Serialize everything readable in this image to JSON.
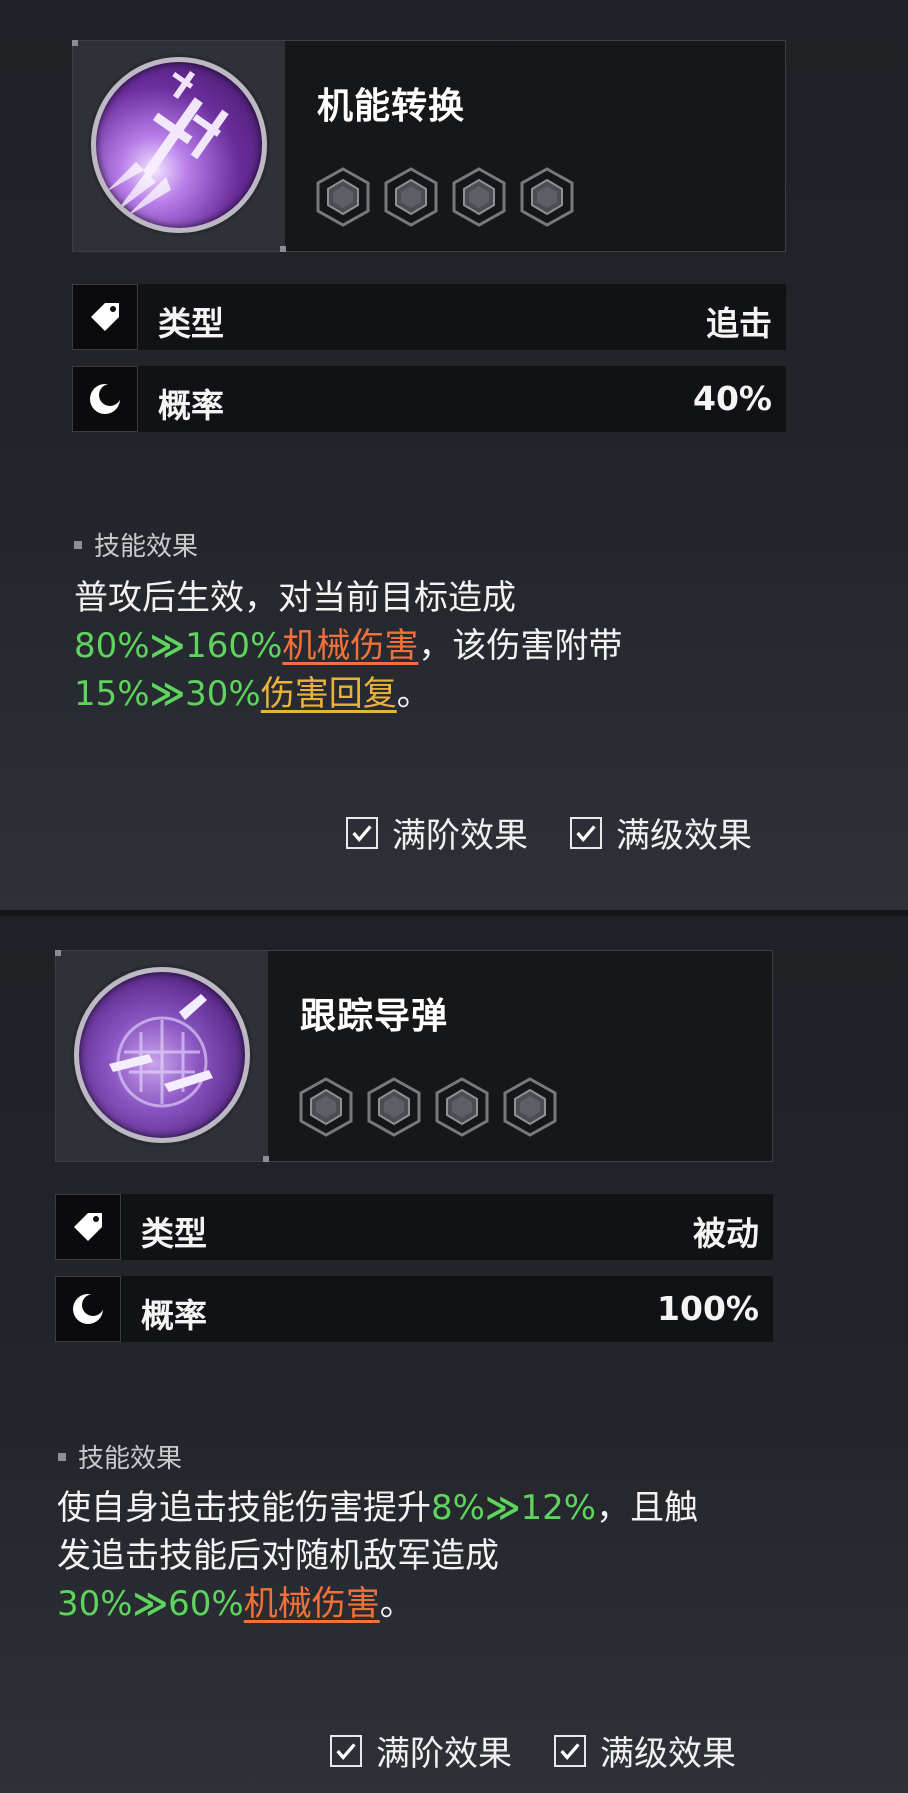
{
  "colors": {
    "accent_green": "#5ed35d",
    "accent_orange": "#f2703a",
    "accent_yellow": "#e9b338",
    "text_white": "#f3f3f3",
    "background": "#1d1f24"
  },
  "skills": [
    {
      "name": "机能转换",
      "emblem_icon": "crossed-swords-slash-icon",
      "stats": [
        {
          "icon": "tag-icon",
          "label": "类型",
          "value": "追击"
        },
        {
          "icon": "crescent-moon-icon",
          "label": "概率",
          "value": "40%"
        }
      ],
      "section_title": "技能效果",
      "desc": {
        "l1": "普攻后生效，对当前目标造成",
        "l2_v1": "80%",
        "l2_arrow": "≫",
        "l2_v2": "160%",
        "l2_kw": "机械伤害",
        "l2_rest": "，该伤害附带",
        "l3_v1": "15%",
        "l3_arrow": "≫",
        "l3_v2": "30%",
        "l3_kw": "伤害回复",
        "l3_rest": "。"
      },
      "options": [
        {
          "label": "满阶效果",
          "checked": true
        },
        {
          "label": "满级效果",
          "checked": true
        }
      ]
    },
    {
      "name": "跟踪导弹",
      "emblem_icon": "missile-barrage-icon",
      "stats": [
        {
          "icon": "tag-icon",
          "label": "类型",
          "value": "被动"
        },
        {
          "icon": "crescent-moon-icon",
          "label": "概率",
          "value": "100%"
        }
      ],
      "section_title": "技能效果",
      "desc": {
        "l1_text": "使自身追击技能伤害提升",
        "l1_v1": "8%",
        "l1_arrow": "≫",
        "l1_v2": "12%",
        "l1_rest": "，且触",
        "l2": "发追击技能后对随机敌军造成",
        "l3_v1": "30%",
        "l3_arrow": "≫",
        "l3_v2": "60%",
        "l3_kw": "机械伤害",
        "l3_rest": "。"
      },
      "options": [
        {
          "label": "满阶效果",
          "checked": true
        },
        {
          "label": "满级效果",
          "checked": true
        }
      ]
    }
  ]
}
